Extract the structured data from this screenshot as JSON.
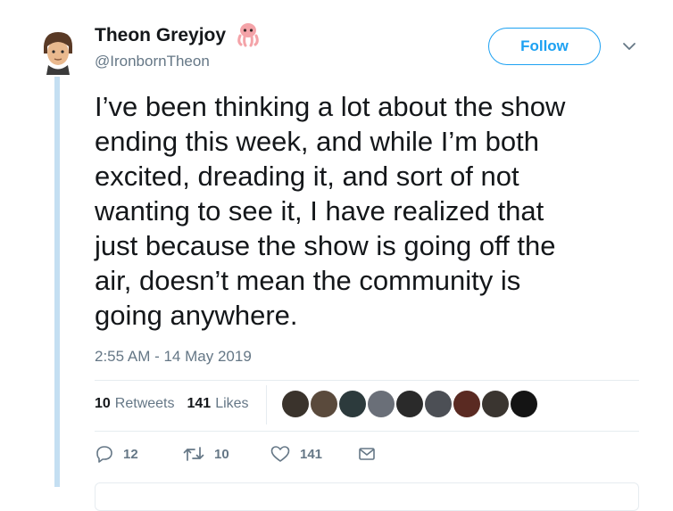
{
  "author": {
    "display_name": "Theon Greyjoy",
    "handle": "@IronbornTheon",
    "name_emoji": "octopus-emoji"
  },
  "follow_label": "Follow",
  "tweet": {
    "text": "I’ve been thinking a lot about the show\nending this week, and while I’m both\nexcited, dreading it, and sort of not\nwanting to see it, I have realized that\njust because the show is going off the\nair, doesn’t mean the community is\ngoing anywhere.",
    "timestamp": "2:55 AM - 14 May 2019"
  },
  "stats": {
    "retweets_count": "10",
    "retweets_label": "Retweets",
    "likes_count": "141",
    "likes_label": "Likes"
  },
  "liker_avatars": [
    {
      "color": "#3a332c"
    },
    {
      "color": "#5a4a3c"
    },
    {
      "color": "#2c3a3c"
    },
    {
      "color": "#6a6f78"
    },
    {
      "color": "#2a2a2a"
    },
    {
      "color": "#4c4f55"
    },
    {
      "color": "#5a2a22"
    },
    {
      "color": "#3a3530"
    },
    {
      "color": "#141414"
    }
  ],
  "actions": {
    "reply_count": "12",
    "retweet_count": "10",
    "like_count": "141"
  },
  "colors": {
    "accent": "#1da1f2",
    "secondary_text": "#657786",
    "thread_line": "#c4dff2"
  }
}
